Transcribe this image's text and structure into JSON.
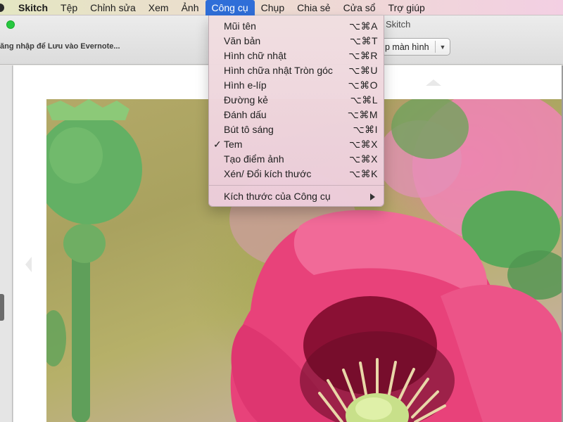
{
  "menubar": {
    "app_name": "Skitch",
    "items": [
      "Tệp",
      "Chỉnh sửa",
      "Xem",
      "Ảnh",
      "Công cụ",
      "Chụp",
      "Chia sẻ",
      "Cửa sổ",
      "Trợ giúp"
    ],
    "active": "Công cụ"
  },
  "window": {
    "title": "Skitch",
    "evernote_link": "ăng nhập để Lưu vào Evernote...",
    "capture_button": "p màn hình"
  },
  "tools_menu": {
    "items": [
      {
        "label": "Mũi tên",
        "shortcut": "⌥⌘A",
        "checked": false
      },
      {
        "label": "Văn bản",
        "shortcut": "⌥⌘T",
        "checked": false
      },
      {
        "label": "Hình chữ nhật",
        "shortcut": "⌥⌘R",
        "checked": false
      },
      {
        "label": "Hình chữa nhật Tròn góc",
        "shortcut": "⌥⌘U",
        "checked": false
      },
      {
        "label": "Hình e-líp",
        "shortcut": "⌥⌘O",
        "checked": false
      },
      {
        "label": "Đường kẻ",
        "shortcut": "⌥⌘L",
        "checked": false
      },
      {
        "label": "Đánh dấu",
        "shortcut": "⌥⌘M",
        "checked": false
      },
      {
        "label": "Bút tô sáng",
        "shortcut": "⌥⌘I",
        "checked": false
      },
      {
        "label": "Tem",
        "shortcut": "⌥⌘X",
        "checked": true
      },
      {
        "label": "Tạo điểm ảnh",
        "shortcut": "⌥⌘X",
        "checked": false
      },
      {
        "label": "Xén/ Đổi kích thước",
        "shortcut": "⌥⌘K",
        "checked": false
      }
    ],
    "submenu_label": "Kích thước của Công cụ",
    "check_glyph": "✓"
  },
  "colors": {
    "menu_highlight": "#2f6ed8",
    "traffic_green": "#27c840",
    "poppy_pink": "#e8427a",
    "poppy_center": "#8a1034",
    "bud_green": "#5fae5f"
  },
  "icons": [
    "apple-menu-icon",
    "checkmark-icon",
    "submenu-arrow-icon",
    "dropdown-arrow-icon",
    "nav-up-arrow-icon",
    "nav-left-arrow-icon"
  ]
}
